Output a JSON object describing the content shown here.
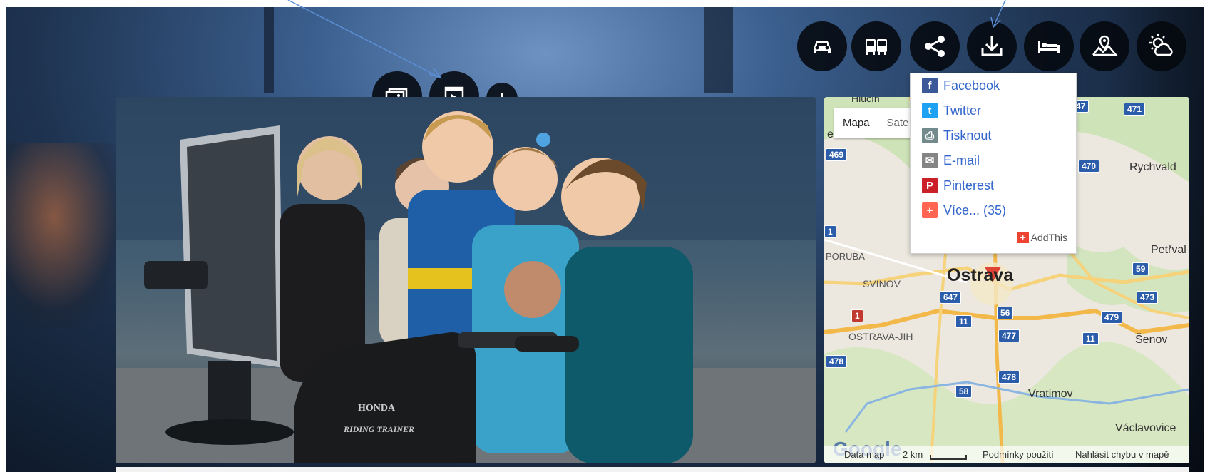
{
  "toolbar": {
    "icons": [
      "car-icon",
      "train-bus-icon",
      "share-icon",
      "download-icon",
      "bed-icon",
      "hiking-icon",
      "weather-icon"
    ]
  },
  "media_buttons": [
    "gallery-icon",
    "video-icon",
    "plus-icon"
  ],
  "photo": {
    "trainer_brand": "HONDA",
    "trainer_model": "RIDING TRAINER"
  },
  "map": {
    "map_button": "Mapa",
    "satellite_button": "Sate",
    "places": {
      "rychvald": "Rychvald",
      "poruba": "PORUBA",
      "petrval": "Petřval",
      "svinov": "SVINOV",
      "ostrava": "Ostrava",
      "ostrava_jih": "OSTRAVA-JIH",
      "senov": "Šenov",
      "vratimov": "Vratimov",
      "vaclavovice": "Václavovice",
      "hlucin": "Hlučín",
      "e_fragment": "e"
    },
    "roads": [
      "469",
      "47",
      "471",
      "470",
      "59",
      "473",
      "647",
      "56",
      "479",
      "11",
      "477",
      "11",
      "478",
      "478",
      "58",
      "1",
      "1"
    ],
    "footer": {
      "google": "Google",
      "data": "Data map",
      "scale": "2 km",
      "terms": "Podmínky použití",
      "report": "Nahlásit chybu v mapě"
    }
  },
  "share_menu": {
    "items": [
      {
        "label": "Facebook",
        "color": "#3b5998"
      },
      {
        "label": "Twitter",
        "color": "#1da1f2"
      },
      {
        "label": "Tisknout",
        "color": "#738a8d"
      },
      {
        "label": "E-mail",
        "color": "#848484"
      },
      {
        "label": "Pinterest",
        "color": "#cb2027"
      },
      {
        "label": "Více... (35)",
        "color": "#ff6550"
      }
    ],
    "brand": "AddThis"
  }
}
